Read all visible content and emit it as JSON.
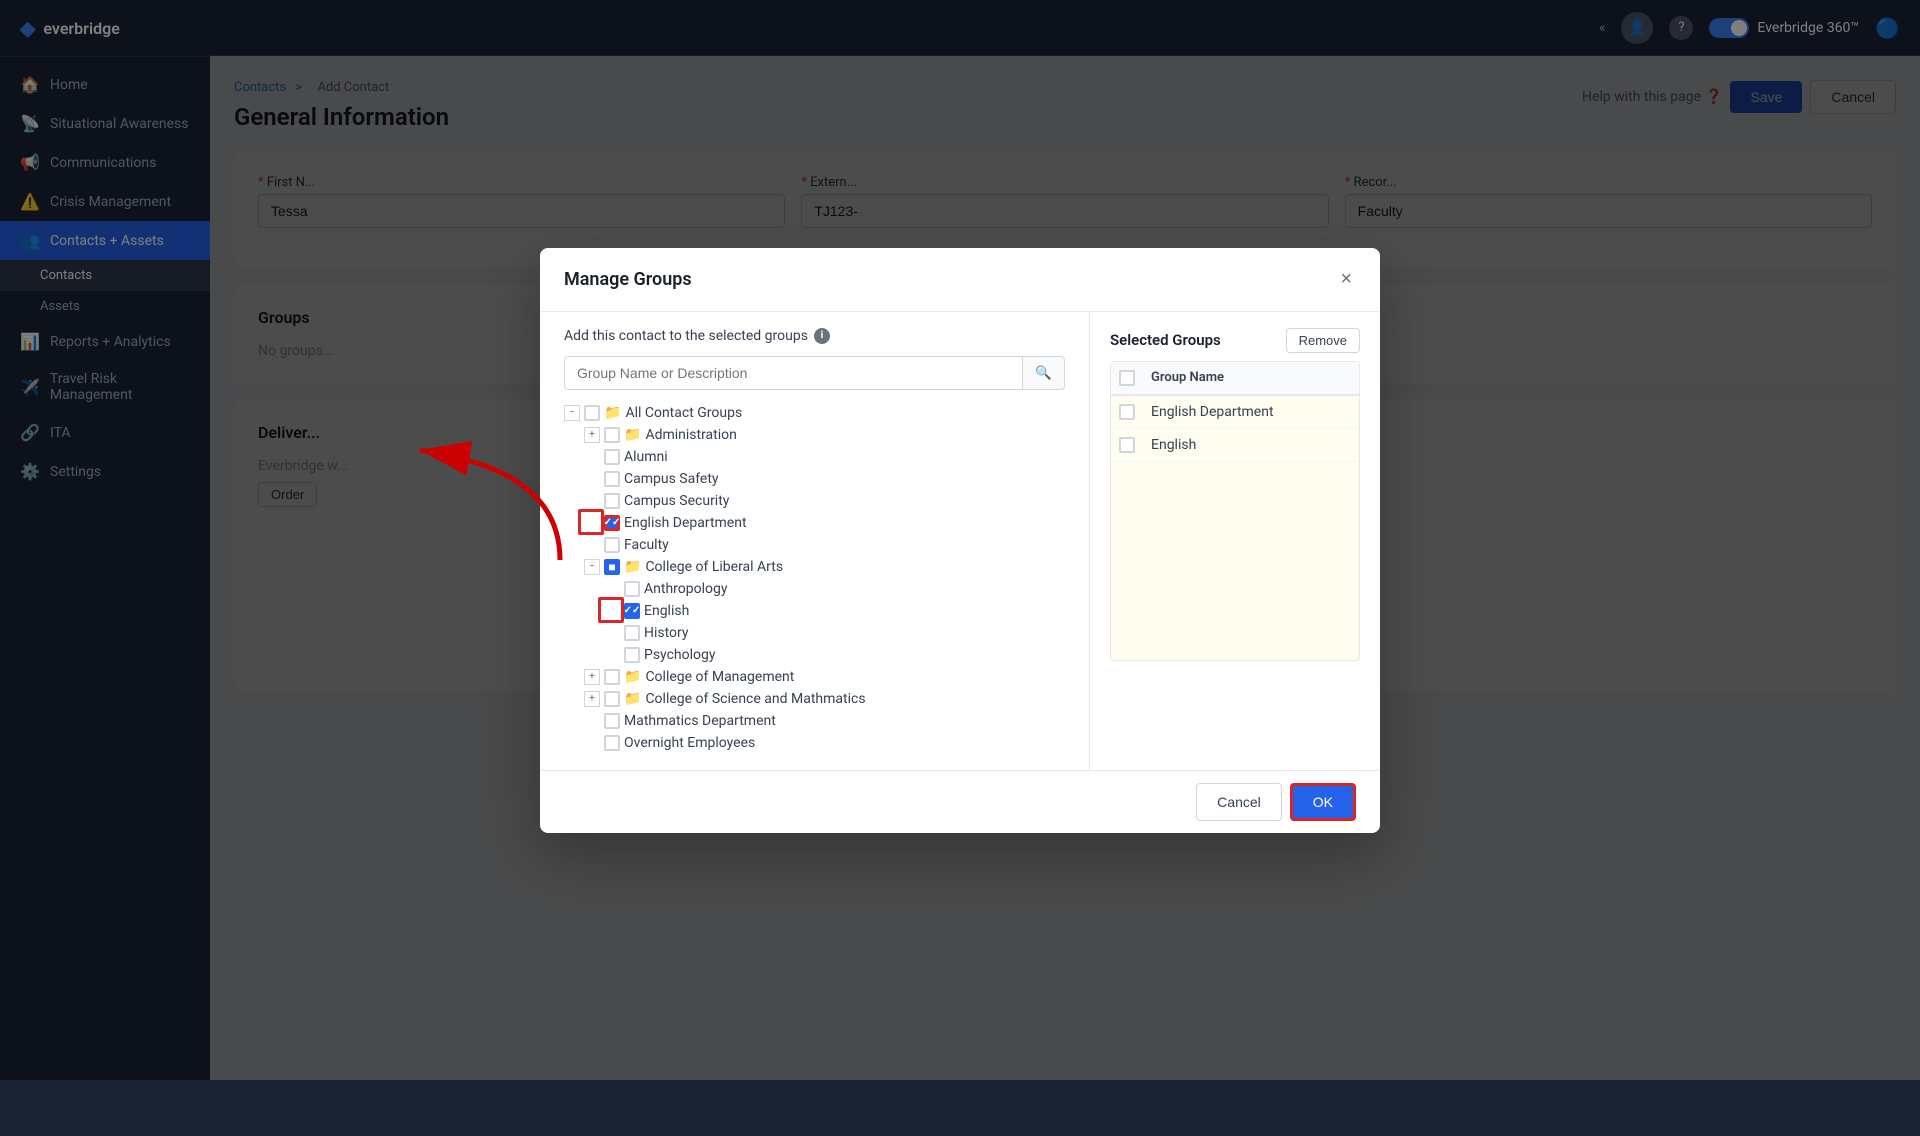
{
  "app": {
    "name": "everbridge",
    "logo_symbol": "◆"
  },
  "topbar": {
    "double_left": "«",
    "avatar_icon": "👤",
    "help_icon": "?",
    "product_label": "Everbridge 360™",
    "product_icon": "🔵"
  },
  "sidebar": {
    "items": [
      {
        "id": "home",
        "label": "Home",
        "icon": "🏠",
        "active": false
      },
      {
        "id": "situational",
        "label": "Situational Awareness",
        "icon": "📡",
        "active": false
      },
      {
        "id": "communications",
        "label": "Communications",
        "icon": "📢",
        "active": false
      },
      {
        "id": "crisis",
        "label": "Crisis Management",
        "icon": "⚠️",
        "active": false
      },
      {
        "id": "contacts-assets",
        "label": "Contacts + Assets",
        "icon": "👥",
        "active": true
      },
      {
        "id": "contacts",
        "label": "Contacts",
        "active": false,
        "sub": true
      },
      {
        "id": "assets",
        "label": "Assets",
        "active": false,
        "sub": true
      },
      {
        "id": "reports",
        "label": "Reports + Analytics",
        "icon": "📊",
        "active": false
      },
      {
        "id": "travel",
        "label": "Travel Risk Management",
        "icon": "✈️",
        "active": false
      },
      {
        "id": "ita",
        "label": "ITA",
        "icon": "🔗",
        "active": false
      },
      {
        "id": "settings",
        "label": "Settings",
        "icon": "⚙️",
        "active": false
      }
    ]
  },
  "breadcrumb": {
    "parent": "Contacts",
    "separator": ">",
    "current": "Add Contact"
  },
  "page": {
    "title": "General Information",
    "help_text": "Help with this page",
    "save_label": "Save",
    "cancel_label": "Cancel"
  },
  "form": {
    "first_name_label": "* First N...",
    "first_name_value": "Tessa",
    "external_label": "* Extern...",
    "external_value": "TJ123-",
    "record_label": "* Recor...",
    "record_value": "Faculty"
  },
  "sections": {
    "groups_title": "Groups",
    "no_groups_text": "No groups...",
    "delivery_title": "Deliver...",
    "delivery_text": "Everbridge w...",
    "order_label": "Order"
  },
  "modal": {
    "title": "Manage Groups",
    "subtitle": "Add this contact to the selected groups",
    "info_icon": "i",
    "search_placeholder": "Group Name or Description",
    "close_icon": "×",
    "ok_label": "OK",
    "cancel_label": "Cancel",
    "tree": {
      "root_label": "All Contact Groups",
      "items": [
        {
          "id": "administration",
          "label": "Administration",
          "level": 2,
          "type": "folder",
          "expandable": true,
          "checked": false
        },
        {
          "id": "alumni",
          "label": "Alumni",
          "level": 2,
          "type": "leaf",
          "checked": false
        },
        {
          "id": "campus-safety",
          "label": "Campus Safety",
          "level": 2,
          "type": "leaf",
          "checked": false
        },
        {
          "id": "campus-security",
          "label": "Campus Security",
          "level": 2,
          "type": "leaf",
          "checked": false
        },
        {
          "id": "english-dept",
          "label": "English Department",
          "level": 2,
          "type": "leaf",
          "checked": true,
          "red_highlight": true
        },
        {
          "id": "faculty",
          "label": "Faculty",
          "level": 2,
          "type": "leaf",
          "checked": false
        },
        {
          "id": "college-liberal-arts",
          "label": "College of Liberal Arts",
          "level": 2,
          "type": "folder",
          "expandable": true,
          "expanded": true,
          "checked": true,
          "partial": true
        },
        {
          "id": "anthropology",
          "label": "Anthropology",
          "level": 3,
          "type": "leaf",
          "checked": false
        },
        {
          "id": "english",
          "label": "English",
          "level": 3,
          "type": "leaf",
          "checked": true,
          "red_highlight": true
        },
        {
          "id": "history",
          "label": "History",
          "level": 3,
          "type": "leaf",
          "checked": false
        },
        {
          "id": "psychology",
          "label": "Psychology",
          "level": 3,
          "type": "leaf",
          "checked": false
        },
        {
          "id": "college-management",
          "label": "College of Management",
          "level": 2,
          "type": "folder",
          "expandable": true,
          "checked": false
        },
        {
          "id": "college-science",
          "label": "College of Science and Mathmatics",
          "level": 2,
          "type": "folder",
          "expandable": true,
          "checked": false
        },
        {
          "id": "mathmatics-dept",
          "label": "Mathmatics Department",
          "level": 2,
          "type": "leaf",
          "checked": false
        },
        {
          "id": "overnight-employees",
          "label": "Overnight Employees",
          "level": 2,
          "type": "leaf",
          "checked": false
        }
      ]
    },
    "selected_groups": {
      "title": "Selected Groups",
      "remove_label": "Remove",
      "column_header": "Group Name",
      "items": [
        {
          "id": "sg-header",
          "name": "Group Name",
          "header": true
        },
        {
          "id": "sg-english-dept",
          "name": "English Department"
        },
        {
          "id": "sg-english",
          "name": "English"
        }
      ]
    }
  },
  "annotation": {
    "arrow_description": "Arrow pointing from English checkbox to English Department checkbox"
  }
}
